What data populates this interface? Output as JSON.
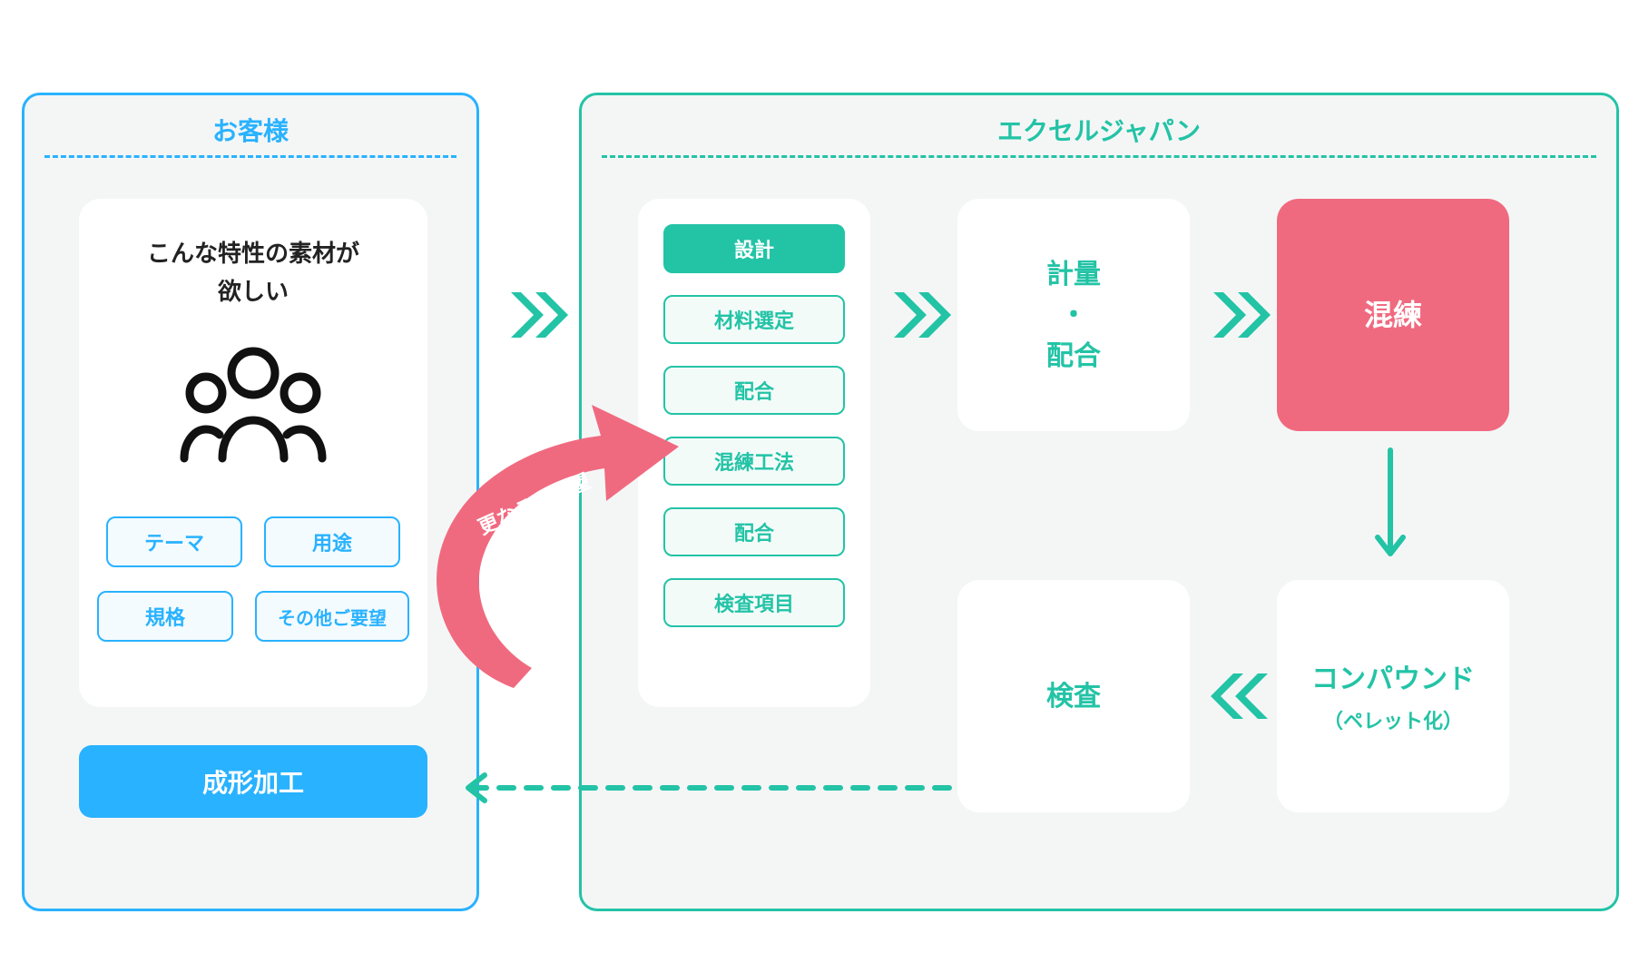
{
  "customer": {
    "title": "お客様",
    "card_heading_line1": "こんな特性の素材が",
    "card_heading_line2": "欲しい",
    "tags": {
      "theme": "テーマ",
      "use": "用途",
      "standard": "規格",
      "other": "その他ご要望"
    },
    "molding": "成形加工"
  },
  "company": {
    "title": "エクセルジャパン",
    "design": {
      "items": [
        "設計",
        "材料選定",
        "配合",
        "混練工法",
        "配合",
        "検査項目"
      ],
      "active_index": 0
    },
    "measure_line1": "計量",
    "measure_dot": "・",
    "measure_line2": "配合",
    "kneading": "混練",
    "compound_line1": "コンパウンド",
    "compound_line2": "（ペレット化）",
    "inspection": "検査"
  },
  "feedback_label": "更なるご要望",
  "colors": {
    "customer": "#29b2ff",
    "company": "#23c3a6",
    "accent_pink": "#f06a7f"
  }
}
